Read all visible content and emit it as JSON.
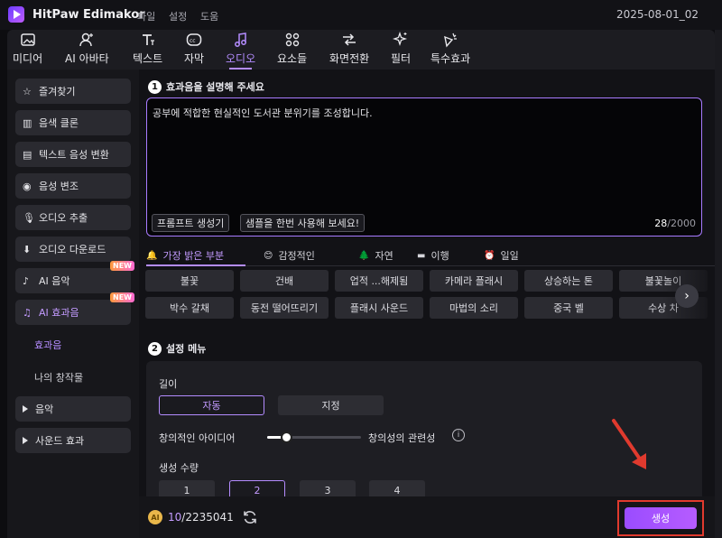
{
  "app": {
    "title": "HitPaw Edimakor",
    "date": "2025-08-01_02"
  },
  "menu": [
    "파일",
    "설정",
    "도움"
  ],
  "tabs": [
    {
      "label": "미디어",
      "icon": "media-icon"
    },
    {
      "label": "AI 아바타",
      "icon": "avatar-icon"
    },
    {
      "label": "텍스트",
      "icon": "text-icon"
    },
    {
      "label": "자막",
      "icon": "subtitle-icon"
    },
    {
      "label": "오디오",
      "icon": "audio-icon",
      "active": true
    },
    {
      "label": "요소들",
      "icon": "elements-icon"
    },
    {
      "label": "화면전환",
      "icon": "transition-icon"
    },
    {
      "label": "필터",
      "icon": "filter-icon"
    },
    {
      "label": "특수효과",
      "icon": "effects-icon"
    }
  ],
  "sidebar": {
    "items": [
      {
        "label": "즐겨찾기",
        "icon": "star-icon"
      },
      {
        "label": "음색 클론",
        "icon": "voice-clone-icon"
      },
      {
        "label": "텍스트 음성 변환",
        "icon": "tts-icon"
      },
      {
        "label": "음성 변조",
        "icon": "voice-change-icon"
      },
      {
        "label": "오디오 추출",
        "icon": "mic-icon"
      },
      {
        "label": "오디오 다운로드",
        "icon": "download-icon"
      },
      {
        "label": "AI 음악",
        "icon": "ai-music-icon",
        "badge": "NEW"
      },
      {
        "label": "AI 효과음",
        "icon": "ai-sfx-icon",
        "badge": "NEW",
        "active": true
      }
    ],
    "sub_items": [
      {
        "label": "효과음",
        "active": true
      },
      {
        "label": "나의 창작물"
      }
    ],
    "groups": [
      {
        "label": "음악"
      },
      {
        "label": "사운드 효과"
      }
    ]
  },
  "step1": {
    "number": "1",
    "title": "효과음을 설명해 주세요",
    "prompt": "공부에 적합한 현실적인 도서관 분위기를 조성합니다.",
    "prompt_generator_label": "프롬프트 생성기",
    "try_sample_label": "샘플을 한번 사용해 보세요!",
    "count": "28",
    "max": "/2000"
  },
  "categories": [
    {
      "label": "가장 밝은 부분",
      "icon": "🔔",
      "active": true
    },
    {
      "label": "감정적인",
      "icon": "😊"
    },
    {
      "label": "자연",
      "icon": "🌲"
    },
    {
      "label": "이행",
      "icon": "▬"
    },
    {
      "label": "일일",
      "icon": "⏰"
    }
  ],
  "chips_row1": [
    "불꽃",
    "건배",
    "업적 ...해제됨",
    "카메라 플래시",
    "상승하는 톤",
    "불꽃놀이 "
  ],
  "chips_row2": [
    "박수 갈채",
    "동전 떨어뜨리기",
    "플래시 사운드",
    "마법의 소리",
    "중국 벨",
    "수상 차"
  ],
  "step2": {
    "number": "2",
    "title": "설정 메뉴",
    "length_label": "길이",
    "length_options": [
      "자동",
      "지정"
    ],
    "creativity_label": "창의적인 아이디어",
    "relevance_label": "창의성의 관련성",
    "slider_value": 0.2,
    "count_label": "생성 수량",
    "count_options": [
      "1",
      "2",
      "3",
      "4"
    ],
    "count_selected": "2"
  },
  "footer": {
    "coin_label": "AI",
    "credits_used": "10",
    "credits_total": "/2235041",
    "generate_label": "생성"
  },
  "colors": {
    "accent": "#b48cff",
    "highlight": "#e03a2e",
    "button": "#a352ff"
  }
}
